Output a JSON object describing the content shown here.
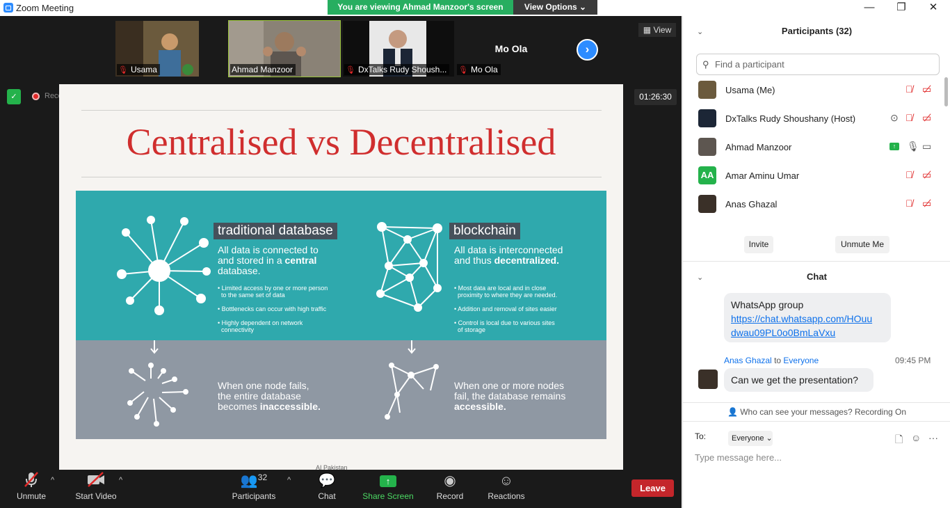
{
  "window": {
    "title": "Zoom Meeting",
    "banner": "You are viewing Ahmad Manzoor's screen",
    "view_options": "View Options ⌄",
    "controls": [
      "—",
      "❐",
      "✕"
    ]
  },
  "strip": {
    "tiles": [
      {
        "name": "Usama"
      },
      {
        "name": "Ahmad Manzoor"
      },
      {
        "name": "DxTalks Rudy Shoush..."
      },
      {
        "name": "Mo Ola",
        "big": "Mo Ola"
      }
    ],
    "view_label": "View"
  },
  "status": {
    "recording": "Recording",
    "timer": "01:26:30"
  },
  "slide": {
    "title": "Centralised vs Decentralised",
    "left_label": "traditional database",
    "left_sub_1": "All data is connected to",
    "left_sub_2": "and stored in a ",
    "left_sub_bold": "central",
    "left_sub_3": "database.",
    "left_bullets": [
      "Limited access by one or more person",
      "to the same set of data",
      "Bottlenecks can occur with high traffic",
      "Highly dependent on network",
      "connectivity"
    ],
    "right_label": "blockchain",
    "right_sub_1": "All data is interconnected",
    "right_sub_2": "and thus ",
    "right_sub_bold": "decentralized.",
    "right_bullets": [
      "Most data are local and in close",
      "proximity to where they are needed.",
      "Addition and removal of sites easier",
      "Control is local due to various sites",
      "of storage"
    ],
    "fail_left_1": "When one node fails,",
    "fail_left_2": "the entire database",
    "fail_left_3": "becomes ",
    "fail_left_bold": "inaccessible.",
    "fail_right_1": "When one or more nodes",
    "fail_right_2": "fail, the database remains",
    "fail_right_bold": "accessible.",
    "footer": "AI Pakistan"
  },
  "toolbar": {
    "unmute": "Unmute",
    "start_video": "Start Video",
    "participants": "Participants",
    "participants_count": "32",
    "chat": "Chat",
    "share_screen": "Share Screen",
    "record": "Record",
    "reactions": "Reactions",
    "leave": "Leave"
  },
  "participants_panel": {
    "title": "Participants (32)",
    "search_placeholder": "Find a participant",
    "list": [
      {
        "name": "Usama  (Me)"
      },
      {
        "name": "DxTalks Rudy Shoushany (Host)"
      },
      {
        "name": "Ahmad Manzoor"
      },
      {
        "name": "Amar Aminu Umar",
        "initials": "AA"
      },
      {
        "name": "Anas Ghazal"
      }
    ],
    "invite": "Invite",
    "unmute_me": "Unmute Me"
  },
  "chat_panel": {
    "title": "Chat",
    "msg1_text": "WhatsApp group",
    "msg1_link_1": "https://chat.whatsapp.com/HOuu",
    "msg1_link_2": "dwau09PL0o0BmLaVxu",
    "msg2_sender": "Anas Ghazal",
    "msg2_to_word": "to",
    "msg2_recipient": "Everyone",
    "msg2_time": "09:45 PM",
    "msg2_text": "Can we get the presentation?",
    "who_can_see": "Who can see your messages? Recording On",
    "to_label": "To:",
    "to_value": "Everyone",
    "input_placeholder": "Type message here..."
  },
  "colors": {
    "accent": "#2d8cff",
    "banner_green": "#27ae60",
    "leave_red": "#c4262b",
    "slide_title_red": "#d02e2e",
    "slide_teal": "#2fa9ad",
    "slide_grey": "#8f98a3"
  }
}
